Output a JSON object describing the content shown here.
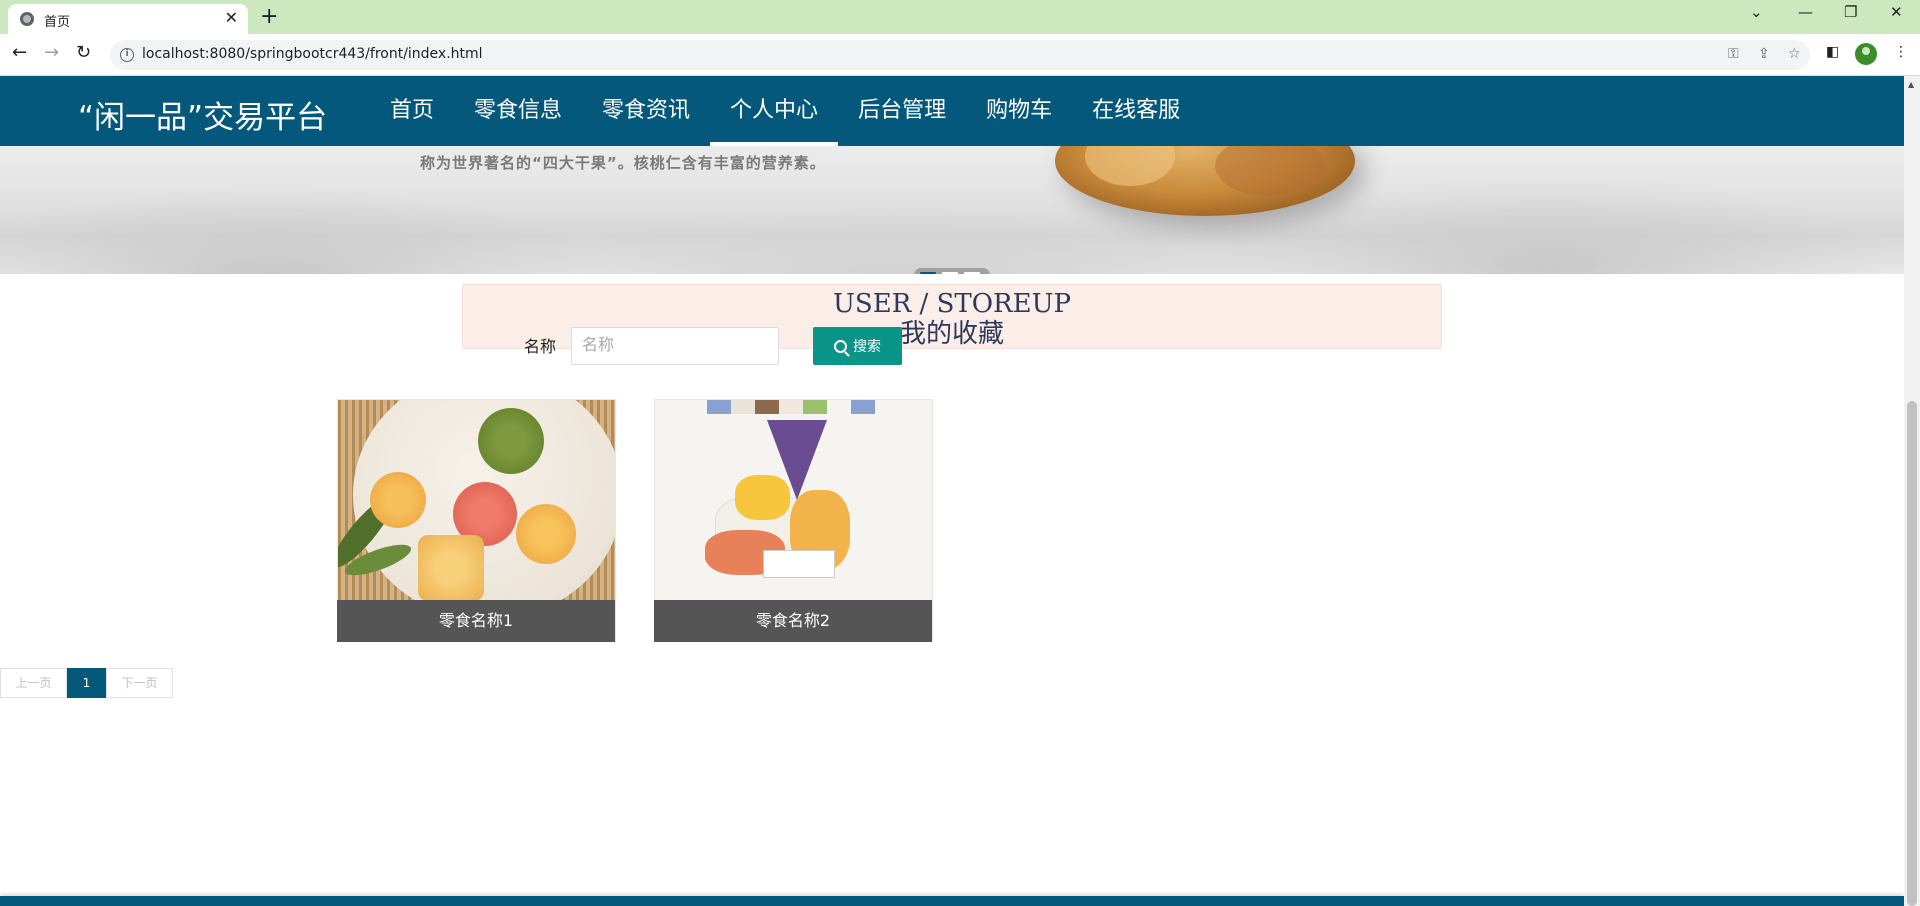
{
  "browser": {
    "tab_title": "首页",
    "url": "localhost:8080/springbootcr443/front/index.html"
  },
  "header": {
    "brand": "“闲一品”交易平台",
    "menu": [
      {
        "label": "首页",
        "active": false
      },
      {
        "label": "零食信息",
        "active": false
      },
      {
        "label": "零食资讯",
        "active": false
      },
      {
        "label": "个人中心",
        "active": true
      },
      {
        "label": "后台管理",
        "active": false
      },
      {
        "label": "购物车",
        "active": false
      },
      {
        "label": "在线客服",
        "active": false
      }
    ]
  },
  "banner": {
    "caption": "称为世界著名的“四大干果”。核桃仁含有丰富的营养素。",
    "slide_count": 3,
    "active_slide": 1
  },
  "section": {
    "title_en": "USER / STOREUP",
    "title_cn": "我的收藏"
  },
  "search": {
    "label": "名称",
    "placeholder": "名称",
    "value": "",
    "button_label": "搜索"
  },
  "items": [
    {
      "name": "零食名称1"
    },
    {
      "name": "零食名称2"
    }
  ],
  "pagination": {
    "prev_label": "上一页",
    "current_page": "1",
    "next_label": "下一页"
  },
  "colors": {
    "primary": "#03587c",
    "search_button": "#0b9488",
    "title_bg": "#fbede8"
  }
}
